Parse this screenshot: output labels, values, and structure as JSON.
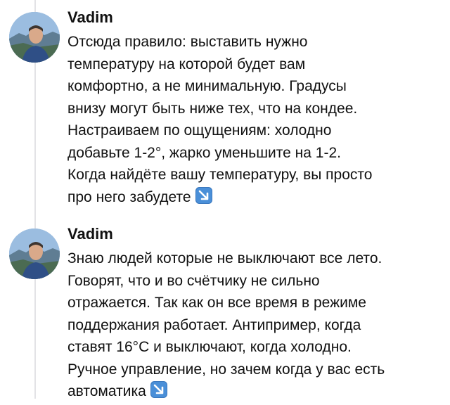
{
  "posts": [
    {
      "author": "Vadim",
      "text": "Отсюда правило: выставить нужно\nтемпературу на которой будет вам\nкомфортно, а не минимальную. Градусы\nвнизу могут быть ниже тех, что на кондее.\nНастраиваем по ощущениям: холодно\nдобавьте 1-2°, жарко уменьшите на 1-2.\nКогда найдёте вашу температуру, вы просто\nпро него забудете",
      "emoji": "down-right-arrow-icon"
    },
    {
      "author": "Vadim",
      "text": "Знаю людей которые не выключают все лето.\nГоворят, что и во счётчику не сильно\nотражается. Так как он все время в режиме\nподдержания работает. Антипример, когда\nставят 16°C и выключают, когда холодно.\nРучное управление, но зачем когда у вас есть\nавтоматика",
      "emoji": "down-right-arrow-icon"
    }
  ],
  "colors": {
    "thread_line": "#e3e3e6",
    "emoji_bg": "#4a8fd8",
    "text": "#111111"
  }
}
